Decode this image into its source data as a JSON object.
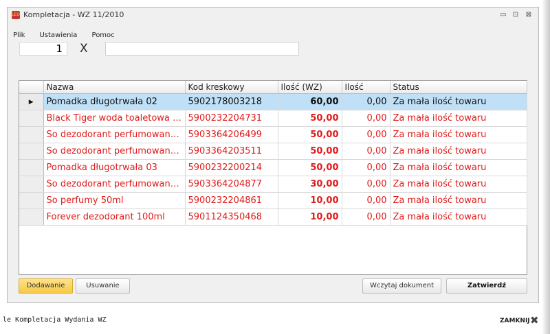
{
  "window": {
    "icon_text": "LEO",
    "title": "Kompletacja - WZ 11/2010",
    "controls": {
      "minimize": "▭",
      "maximize": "⊡",
      "close": "⊠"
    }
  },
  "menu": [
    "Plik",
    "Ustawienia",
    "Pomoc"
  ],
  "entry": {
    "quantity": "1",
    "multiply_sign": "X",
    "barcode_value": ""
  },
  "grid": {
    "columns": [
      "",
      "Nazwa",
      "Kod kreskowy",
      "Ilość (WZ)",
      "Ilość",
      "Status"
    ],
    "selected_marker": "▶",
    "rows": [
      {
        "nazwa": "Pomadka długotrwała 02",
        "kod": "5902178003218",
        "ilosc_wz": "60,00",
        "ilosc": "0,00",
        "status": "Za mała ilość towaru",
        "selected": true
      },
      {
        "nazwa": "Black Tiger woda toaletowa 1...",
        "kod": "5900232204731",
        "ilosc_wz": "50,00",
        "ilosc": "0,00",
        "status": "Za mała ilość towaru",
        "selected": false
      },
      {
        "nazwa": "So dezodorant perfumowany ...",
        "kod": "5903364206499",
        "ilosc_wz": "50,00",
        "ilosc": "0,00",
        "status": "Za mała ilość towaru",
        "selected": false
      },
      {
        "nazwa": "So dezodorant perfumowany ...",
        "kod": "5903364203511",
        "ilosc_wz": "50,00",
        "ilosc": "0,00",
        "status": "Za mała ilość towaru",
        "selected": false
      },
      {
        "nazwa": "Pomadka długotrwała 03",
        "kod": "5900232200214",
        "ilosc_wz": "50,00",
        "ilosc": "0,00",
        "status": "Za mała ilość towaru",
        "selected": false
      },
      {
        "nazwa": "So dezodorant perfumowany ...",
        "kod": "5903364204877",
        "ilosc_wz": "30,00",
        "ilosc": "0,00",
        "status": "Za mała ilość towaru",
        "selected": false
      },
      {
        "nazwa": "So perfumy 50ml",
        "kod": "5900232204861",
        "ilosc_wz": "10,00",
        "ilosc": "0,00",
        "status": "Za mała ilość towaru",
        "selected": false
      },
      {
        "nazwa": "Forever dezodorant 100ml",
        "kod": "5901124350468",
        "ilosc_wz": "10,00",
        "ilosc": "0,00",
        "status": "Za mała ilość towaru",
        "selected": false
      }
    ]
  },
  "buttons": {
    "add": "Dodawanie",
    "remove": "Usuwanie",
    "load": "Wczytaj dokument",
    "confirm": "Zatwierdź"
  },
  "footer": {
    "text": "le Kompletacja Wydania WZ",
    "close_label": "ZAMKNIJ",
    "close_icon": "✖"
  },
  "colors": {
    "error_text": "#e01a1a",
    "selection": "#bfe0f7",
    "accent_button": "#f6c947"
  }
}
